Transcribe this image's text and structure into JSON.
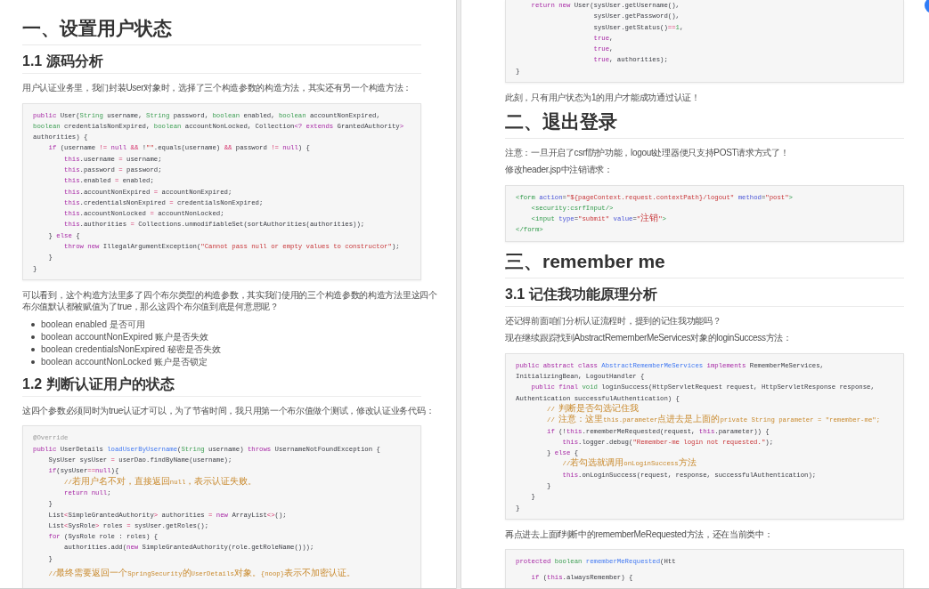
{
  "pages": [
    {
      "blocks": [
        {
          "kind": "h1",
          "text": "一、设置用户状态"
        },
        {
          "kind": "h2",
          "text": "1.1 源码分析"
        },
        {
          "kind": "p",
          "text": "用户认证业务里，我们封装User对象时，选择了三个构造参数的构造方法，其实还有另一个构造方法："
        },
        {
          "kind": "code",
          "continues_above": false,
          "continues_below": false,
          "groups": [
            [
              [
                {
                  "kind": "keyword",
                  "text": "public"
                },
                " User(",
                {
                  "kind": "type",
                  "text": "String"
                },
                " username, ",
                {
                  "kind": "type",
                  "text": "String"
                },
                " password, ",
                {
                  "kind": "type",
                  "text": "boolean"
                },
                " enabled, ",
                {
                  "kind": "type",
                  "text": "boolean"
                },
                " accountNonExpired,"
              ],
              [
                {
                  "kind": "type",
                  "text": "boolean"
                },
                " credentialsNonExpired, ",
                {
                  "kind": "type",
                  "text": "boolean"
                },
                " accountNonLocked, Collection",
                {
                  "kind": "keyword",
                  "text": "<? extends"
                },
                " GrantedAuthority",
                {
                  "kind": "keyword",
                  "text": ">"
                }
              ],
              [
                "authorities) {"
              ],
              [
                {
                  "kind": "keyword",
                  "text": "    if"
                },
                " (username ",
                {
                  "kind": "operator",
                  "text": "!="
                },
                {
                  "kind": "keyword",
                  "text": " null"
                },
                {
                  "kind": "operator",
                  "text": " &&"
                },
                " !",
                {
                  "kind": "string",
                  "text": "\"\""
                },
                ".equals(username) ",
                {
                  "kind": "operator",
                  "text": "&&"
                },
                " password ",
                {
                  "kind": "operator",
                  "text": "!="
                },
                {
                  "kind": "keyword",
                  "text": " null"
                },
                ") {"
              ],
              [
                {
                  "kind": "keyword",
                  "text": "        this"
                },
                ".username ",
                {
                  "kind": "operator",
                  "text": "="
                },
                " username;"
              ],
              [
                {
                  "kind": "keyword",
                  "text": "        this"
                },
                ".password ",
                {
                  "kind": "operator",
                  "text": "="
                },
                " password;"
              ],
              [
                {
                  "kind": "keyword",
                  "text": "        this"
                },
                ".enabled ",
                {
                  "kind": "operator",
                  "text": "="
                },
                " enabled;"
              ],
              [
                {
                  "kind": "keyword",
                  "text": "        this"
                },
                ".accountNonExpired ",
                {
                  "kind": "operator",
                  "text": "="
                },
                " accountNonExpired;"
              ],
              [
                {
                  "kind": "keyword",
                  "text": "        this"
                },
                ".credentialsNonExpired ",
                {
                  "kind": "operator",
                  "text": "="
                },
                " credentialsNonExpired;"
              ],
              [
                {
                  "kind": "keyword",
                  "text": "        this"
                },
                ".accountNonLocked ",
                {
                  "kind": "operator",
                  "text": "="
                },
                " accountNonLocked;"
              ],
              [
                {
                  "kind": "keyword",
                  "text": "        this"
                },
                ".authorities ",
                {
                  "kind": "operator",
                  "text": "="
                },
                " Collections.unmodifiableSet(sortAuthorities(authorities));"
              ],
              [
                "    } ",
                {
                  "kind": "keyword",
                  "text": "else"
                },
                " {"
              ],
              [
                {
                  "kind": "keyword",
                  "text": "        throw"
                },
                {
                  "kind": "keyword",
                  "text": " new"
                },
                " IllegalArgumentException(",
                {
                  "kind": "string",
                  "text": "\"Cannot pass null or empty values to constructor\""
                },
                ");"
              ],
              [
                "    }"
              ],
              [
                "}"
              ]
            ]
          ]
        },
        {
          "kind": "p",
          "text": "可以看到，这个构造方法里多了四个布尔类型的构造参数，其实我们使用的三个构造参数的构造方法里这四个布尔值默认都被赋值为了true，那么这四个布尔值到底是何意思呢？"
        },
        {
          "kind": "list",
          "items": [
            "boolean enabled 是否可用",
            "boolean accountNonExpired 账户是否失效",
            "boolean credentialsNonExpired 秘密是否失效",
            "boolean accountNonLocked 账户是否锁定"
          ]
        },
        {
          "kind": "h2",
          "text": "1.2 判断认证用户的状态"
        },
        {
          "kind": "p",
          "text": "这四个参数必须同时为true认证才可以，为了节省时间，我只用第一个布尔值做个测试，修改认证业务代码："
        },
        {
          "kind": "code",
          "continues_above": false,
          "continues_below": true,
          "groups": [
            [
              [
                {
                  "kind": "annotation",
                  "text": "@Override"
                }
              ],
              [
                {
                  "kind": "keyword",
                  "text": "public"
                },
                " UserDetails ",
                {
                  "kind": "function",
                  "text": "loadUserByUsername"
                },
                "(",
                {
                  "kind": "type",
                  "text": "String"
                },
                " username) ",
                {
                  "kind": "keyword",
                  "text": "throws"
                },
                " UsernameNotFoundException {"
              ],
              [
                "    SysUser sysUser ",
                {
                  "kind": "operator",
                  "text": "="
                },
                " userDao.findByName(username);"
              ],
              [
                {
                  "kind": "keyword",
                  "text": "    if"
                },
                "(sysUser",
                {
                  "kind": "operator",
                  "text": "=="
                },
                {
                  "kind": "keyword",
                  "text": "null"
                },
                "){"
              ],
              [
                {
                  "kind": "comment",
                  "text": "        //若用户名不对，直接返回null，表示认证失败。"
                }
              ],
              [
                {
                  "kind": "keyword",
                  "text": "        return"
                },
                {
                  "kind": "keyword",
                  "text": " null"
                },
                ";"
              ],
              [
                "    }"
              ],
              [
                "    List",
                {
                  "kind": "operator",
                  "text": "<"
                },
                "SimpleGrantedAuthority",
                {
                  "kind": "operator",
                  "text": ">"
                },
                " authorities ",
                {
                  "kind": "operator",
                  "text": "="
                },
                {
                  "kind": "keyword",
                  "text": " new"
                },
                " ArrayList",
                {
                  "kind": "operator",
                  "text": "<>"
                },
                "();"
              ],
              [
                "    List",
                {
                  "kind": "operator",
                  "text": "<"
                },
                "SysRole",
                {
                  "kind": "operator",
                  "text": ">"
                },
                " roles ",
                {
                  "kind": "operator",
                  "text": "="
                },
                " sysUser.getRoles();"
              ],
              [
                {
                  "kind": "keyword",
                  "text": "    for"
                },
                " (SysRole role : roles) {"
              ],
              [
                "        authorities.add(",
                {
                  "kind": "keyword",
                  "text": "new"
                },
                " SimpleGrantedAuthority(role.getRoleName()));"
              ],
              [
                "    }"
              ]
            ],
            [
              [
                {
                  "kind": "comment",
                  "text": "    //最终需要返回一个SpringSecurity的UserDetails对象。{noop}表示不加密认证。"
                }
              ]
            ]
          ]
        }
      ]
    },
    {
      "blocks": [
        {
          "kind": "code",
          "continues_above": true,
          "continues_below": false,
          "groups": [
            [
              [
                {
                  "kind": "keyword",
                  "text": "    return"
                },
                {
                  "kind": "keyword",
                  "text": " new"
                },
                " User(sysUser.getUsername(),"
              ],
              [
                "                    sysUser.getPassword(),"
              ],
              [
                "                    sysUser.getStatus()",
                {
                  "kind": "operator",
                  "text": "=="
                },
                {
                  "kind": "number",
                  "text": "1"
                },
                ","
              ],
              [
                {
                  "kind": "keyword",
                  "text": "                    true"
                },
                ","
              ],
              [
                {
                  "kind": "keyword",
                  "text": "                    true"
                },
                ","
              ],
              [
                {
                  "kind": "keyword",
                  "text": "                    true"
                },
                ", authorities);"
              ],
              [
                "}"
              ]
            ]
          ]
        },
        {
          "kind": "p",
          "text": "此刻，只有用户状态为1的用户才能成功通过认证！"
        },
        {
          "kind": "h1",
          "text": "二、退出登录"
        },
        {
          "kind": "p",
          "text": "注意：一旦开启了csrf防护功能，logout处理器便只支持POST请求方式了！"
        },
        {
          "kind": "p",
          "text": "修改header.jsp中注销请求："
        },
        {
          "kind": "code",
          "continues_above": false,
          "continues_below": false,
          "groups": [
            [
              [
                {
                  "kind": "tag",
                  "text": "<form"
                },
                {
                  "kind": "attribute",
                  "text": " action"
                },
                "=",
                {
                  "kind": "string",
                  "text": "\"${pageContext.request.contextPath}/logout\""
                },
                {
                  "kind": "attribute",
                  "text": " method"
                },
                "=",
                {
                  "kind": "string",
                  "text": "\"post\""
                },
                {
                  "kind": "tag",
                  "text": ">"
                }
              ],
              [
                {
                  "kind": "tag",
                  "text": "    <security:csrfInput/>"
                }
              ],
              [
                {
                  "kind": "tag",
                  "text": "    <input"
                },
                {
                  "kind": "attribute",
                  "text": " type"
                },
                "=",
                {
                  "kind": "string",
                  "text": "\"submit\""
                },
                {
                  "kind": "attribute",
                  "text": " value"
                },
                "=",
                {
                  "kind": "string",
                  "text": "\"注销\""
                },
                {
                  "kind": "tag",
                  "text": ">"
                }
              ],
              [
                {
                  "kind": "tag",
                  "text": "</form>"
                }
              ]
            ]
          ]
        },
        {
          "kind": "h1",
          "text": "三、remember me"
        },
        {
          "kind": "h2",
          "text": "3.1 记住我功能原理分析"
        },
        {
          "kind": "p",
          "text": "还记得前面咱们分析认证流程时，提到的记住我功能吗？"
        },
        {
          "kind": "p",
          "text": "现在继续跟踪找到AbstractRememberMeServices对象的loginSuccess方法："
        },
        {
          "kind": "code",
          "continues_above": false,
          "continues_below": false,
          "groups": [
            [
              [
                {
                  "kind": "keyword",
                  "text": "public abstract class"
                },
                {
                  "kind": "function",
                  "text": " AbstractRememberMeServices"
                },
                {
                  "kind": "keyword",
                  "text": " implements"
                },
                " RememberMeServices,"
              ],
              [
                "InitializingBean, LogoutHandler {"
              ],
              [
                {
                  "kind": "keyword",
                  "text": "    public final"
                },
                {
                  "kind": "type",
                  "text": " void"
                },
                " loginSuccess(HttpServletRequest request, HttpServletResponse response,"
              ],
              [
                "Authentication successfulAuthentication) {"
              ],
              [
                {
                  "kind": "comment",
                  "text": "        // 判断是否勾选记住我"
                }
              ],
              [
                {
                  "kind": "comment",
                  "text": "        // 注意：这里this.parameter点进去是上面的private String parameter = \"remember-me\";"
                }
              ],
              [
                {
                  "kind": "keyword",
                  "text": "        if"
                },
                " (!",
                {
                  "kind": "keyword",
                  "text": "this"
                },
                ".rememberMeRequested(request, ",
                {
                  "kind": "keyword",
                  "text": "this"
                },
                ".parameter)) {"
              ],
              [
                {
                  "kind": "keyword",
                  "text": "            this"
                },
                ".logger.debug(",
                {
                  "kind": "string",
                  "text": "\"Remember-me login not requested.\""
                },
                ");"
              ],
              [
                "        } ",
                {
                  "kind": "keyword",
                  "text": "else"
                },
                " {"
              ],
              [
                {
                  "kind": "comment",
                  "text": "            //若勾选就调用onLoginSuccess方法"
                }
              ],
              [
                {
                  "kind": "keyword",
                  "text": "            this"
                },
                ".onLoginSuccess(request, response, successfulAuthentication);"
              ],
              [
                "        }"
              ],
              [
                "    }"
              ],
              [
                "}"
              ]
            ]
          ]
        },
        {
          "kind": "p",
          "text": "再点进去上面if判断中的rememberMeRequested方法，还在当前类中："
        },
        {
          "kind": "code",
          "continues_above": false,
          "continues_below": true,
          "groups": [
            [
              [
                {
                  "kind": "keyword",
                  "text": "protected"
                },
                {
                  "kind": "type",
                  "text": " boolean"
                },
                {
                  "kind": "function",
                  "text": " rememberMeRequested"
                },
                "(Htt"
              ]
            ],
            [
              [
                {
                  "kind": "keyword",
                  "text": "    if"
                },
                " (",
                {
                  "kind": "keyword",
                  "text": "this"
                },
                ".alwaysRemember) {"
              ]
            ]
          ]
        }
      ]
    }
  ]
}
